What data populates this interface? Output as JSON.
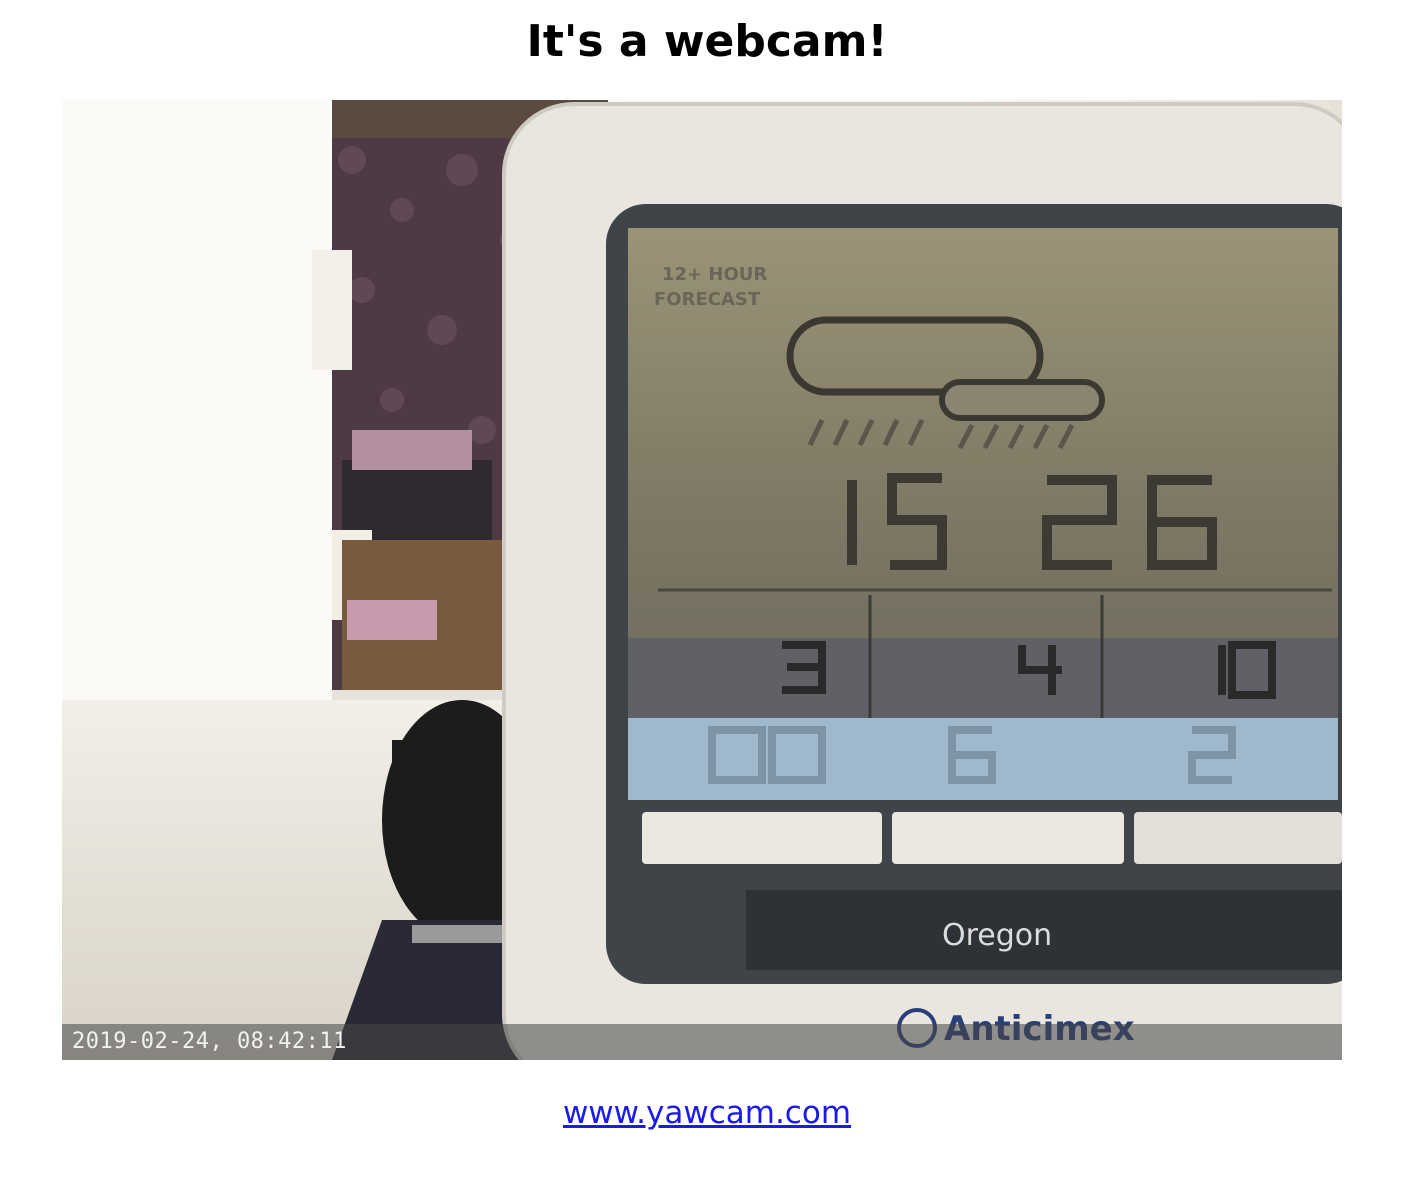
{
  "page": {
    "title": "It's a webcam!"
  },
  "webcam": {
    "timestamp": "2019-02-24, 08:42:11",
    "device": {
      "forecast_label_1": "12+ HOUR",
      "forecast_label_2": "FORECAST",
      "brand": "Oregon",
      "sticker": "Anticimex"
    }
  },
  "footer": {
    "link_text": "www.yawcam.com"
  },
  "colors": {
    "link": "#1a1aee",
    "title": "#000000"
  }
}
